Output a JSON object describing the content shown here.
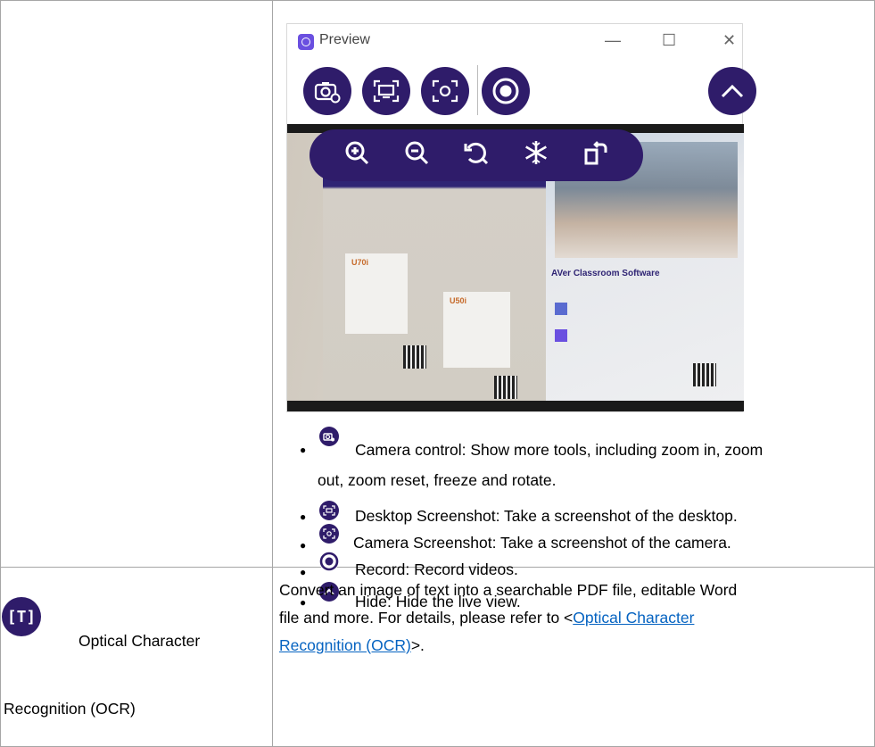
{
  "preview_window": {
    "title": "Preview",
    "controls": {
      "minimize": "—",
      "maximize": "☐",
      "close": "✕"
    },
    "toolbar_icons": [
      "camera-settings-icon",
      "desktop-screenshot-icon",
      "camera-screenshot-icon",
      "record-icon",
      "hide-icon"
    ],
    "zoom_tools": [
      "zoom-in-icon",
      "zoom-out-icon",
      "zoom-reset-icon",
      "freeze-icon",
      "rotate-icon"
    ],
    "photo_text": {
      "heading": "AVer Classroom Software",
      "product1": "U70i",
      "product2": "U50i"
    }
  },
  "bullets": [
    {
      "icon": "camera-control-icon",
      "text_line1": "Camera control: Show more tools, including zoom in, zoom",
      "text_line2": "out, zoom reset, freeze and rotate."
    },
    {
      "icon": "desktop-screenshot-icon",
      "text": "Desktop Screenshot: Take a screenshot of the desktop."
    },
    {
      "icon": "camera-screenshot-icon",
      "text": "Camera Screenshot: Take a screenshot of the camera."
    },
    {
      "icon": "record-icon",
      "text": "Record: Record videos."
    },
    {
      "icon": "hide-icon",
      "text": "Hide: Hide the live view."
    }
  ],
  "ocr_row": {
    "icon": "ocr-icon",
    "icon_glyph": "[T]",
    "name_line1": "Optical Character",
    "name_line2": "Recognition (OCR)",
    "desc_line1": "Convert an image of text into a searchable PDF file, editable Word",
    "desc_line2_prefix": "file and more. For details, please refer to <",
    "link_line1": "Optical Character",
    "link_line2": "Recognition (OCR)",
    "desc_suffix": ">."
  }
}
